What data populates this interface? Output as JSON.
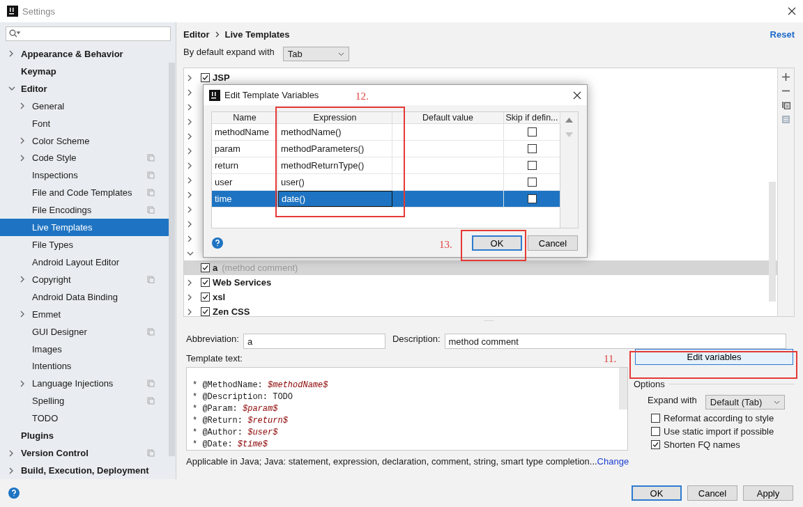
{
  "window": {
    "title": "Settings"
  },
  "sidebar": {
    "items": [
      {
        "label": "Appearance & Behavior",
        "expanded": false,
        "scoped": false,
        "selected": false
      },
      {
        "label": "Keymap",
        "scoped": false,
        "selected": false
      },
      {
        "label": "Editor",
        "expanded": true,
        "scoped": false,
        "selected": false,
        "children": [
          {
            "label": "General",
            "expanded": false,
            "scoped": false,
            "selected": false
          },
          {
            "label": "Font",
            "scoped": false,
            "selected": false
          },
          {
            "label": "Color Scheme",
            "expanded": false,
            "scoped": false,
            "selected": false
          },
          {
            "label": "Code Style",
            "expanded": false,
            "scoped": true,
            "selected": false
          },
          {
            "label": "Inspections",
            "scoped": true,
            "selected": false
          },
          {
            "label": "File and Code Templates",
            "scoped": true,
            "selected": false
          },
          {
            "label": "File Encodings",
            "scoped": true,
            "selected": false
          },
          {
            "label": "Live Templates",
            "scoped": false,
            "selected": true
          },
          {
            "label": "File Types",
            "scoped": false,
            "selected": false
          },
          {
            "label": "Android Layout Editor",
            "scoped": false,
            "selected": false
          },
          {
            "label": "Copyright",
            "expanded": false,
            "scoped": true,
            "selected": false
          },
          {
            "label": "Android Data Binding",
            "scoped": false,
            "selected": false
          },
          {
            "label": "Emmet",
            "expanded": false,
            "scoped": false,
            "selected": false
          },
          {
            "label": "GUI Designer",
            "scoped": true,
            "selected": false
          },
          {
            "label": "Images",
            "scoped": false,
            "selected": false
          },
          {
            "label": "Intentions",
            "scoped": false,
            "selected": false
          },
          {
            "label": "Language Injections",
            "expanded": false,
            "scoped": true,
            "selected": false
          },
          {
            "label": "Spelling",
            "scoped": true,
            "selected": false
          },
          {
            "label": "TODO",
            "scoped": false,
            "selected": false
          }
        ]
      },
      {
        "label": "Plugins",
        "scoped": false,
        "selected": false
      },
      {
        "label": "Version Control",
        "expanded": false,
        "scoped": true,
        "selected": false
      },
      {
        "label": "Build, Execution, Deployment",
        "expanded": false,
        "scoped": false,
        "selected": false
      }
    ]
  },
  "breadcrumb": [
    "Editor",
    "Live Templates"
  ],
  "reset_link": "Reset",
  "expand_with": {
    "label": "By default expand with",
    "value": "Tab"
  },
  "template_groups": [
    {
      "label": "JSP",
      "checked": true,
      "expanded": false,
      "selected": false
    },
    {
      "expanded": false,
      "selected": false
    },
    {
      "expanded": false,
      "selected": false
    },
    {
      "expanded": false,
      "selected": false
    },
    {
      "expanded": false,
      "selected": false
    },
    {
      "expanded": false,
      "selected": false
    },
    {
      "expanded": false,
      "selected": false
    },
    {
      "expanded": false,
      "selected": false
    },
    {
      "expanded": false,
      "selected": false
    },
    {
      "expanded": false,
      "selected": false
    },
    {
      "expanded": false,
      "selected": false
    },
    {
      "expanded": false,
      "selected": false
    },
    {
      "expanded": true,
      "selected": false,
      "children": [
        {
          "label": "a",
          "description": "(method comment)",
          "checked": true,
          "selected": true
        }
      ]
    },
    {
      "label": "Web Services",
      "checked": true,
      "expanded": false,
      "selected": false
    },
    {
      "label": "xsl",
      "checked": true,
      "expanded": false,
      "selected": false
    },
    {
      "label": "Zen CSS",
      "checked": true,
      "expanded": false,
      "selected": false
    }
  ],
  "abbreviation": {
    "label": "Abbreviation:",
    "value": "a"
  },
  "description": {
    "label": "Description:",
    "value": "method comment"
  },
  "template_text": {
    "label": "Template text:",
    "lines": [
      {
        "text": "* @MethodName: ",
        "variable": "$methodName$"
      },
      {
        "text": "* @Description: TODO"
      },
      {
        "text": "* @Param: ",
        "variable": "$param$"
      },
      {
        "text": "* @Return: ",
        "variable": "$return$"
      },
      {
        "text": "* @Author: ",
        "variable": "$user$"
      },
      {
        "text": "* @Date: ",
        "variable": "$time$"
      }
    ]
  },
  "edit_variables": {
    "label": "Edit variables",
    "annotation": "11."
  },
  "options": {
    "title": "Options",
    "expand_with": {
      "label": "Expand with",
      "value": "Default (Tab)"
    },
    "checkboxes": [
      {
        "label": "Reformat according to style",
        "checked": false
      },
      {
        "label": "Use static import if possible",
        "checked": false
      },
      {
        "label": "Shorten FQ names",
        "checked": true
      }
    ]
  },
  "applicable": {
    "text": "Applicable in Java; Java: statement, expression, declaration, comment, string, smart type completion...",
    "link": "Change"
  },
  "footer_buttons": [
    {
      "label": "OK",
      "default": true
    },
    {
      "label": "Cancel",
      "default": false
    },
    {
      "label": "Apply",
      "default": false
    }
  ],
  "dialog": {
    "title": "Edit Template Variables",
    "table_annotation": "12.",
    "ok_annotation": "13.",
    "columns": [
      "Name",
      "Expression",
      "Default value",
      "Skip if defin..."
    ],
    "rows": [
      {
        "name": "methodName",
        "expression": "methodName()",
        "skip": false,
        "selected": false,
        "editing": false
      },
      {
        "name": "param",
        "expression": "methodParameters()",
        "skip": false,
        "selected": false,
        "editing": false
      },
      {
        "name": "return",
        "expression": "methodReturnType()",
        "skip": false,
        "selected": false,
        "editing": false
      },
      {
        "name": "user",
        "expression": "user()",
        "skip": false,
        "selected": false,
        "editing": false
      },
      {
        "name": "time",
        "expression": "date()",
        "skip": false,
        "selected": true,
        "editing": true
      }
    ],
    "buttons": [
      {
        "label": "OK",
        "default": true
      },
      {
        "label": "Cancel",
        "default": false
      }
    ]
  }
}
